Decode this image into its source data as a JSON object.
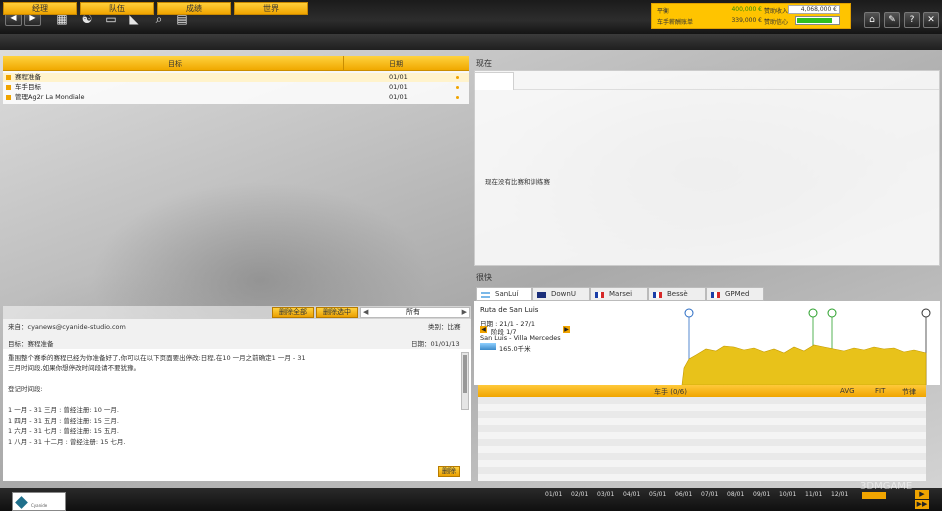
{
  "toolbar": {
    "back_label": "◀",
    "forward_label": "▶",
    "icons": [
      "calendar-icon",
      "team-icon",
      "chart-icon",
      "shoe-icon",
      "search-icon",
      "clipboard-icon"
    ]
  },
  "finance": {
    "balance_label": "平衡",
    "balance_value": "400,000 €",
    "sponsor_income_label": "赞助收入",
    "sponsor_income_value": "4,068,000 €",
    "rider_salary_label": "车手薪酬账单",
    "rider_salary_value": "339,000 €",
    "sponsor_trust_label": "赞助信心",
    "sponsor_trust_level": 0.85
  },
  "right_buttons": [
    "home-icon",
    "wrench-icon",
    "help-icon",
    "close-icon"
  ],
  "right_button_labels": [
    "⌂",
    "✎",
    "?",
    "✕"
  ],
  "nav": {
    "tabs": [
      "经理",
      "队伍",
      "成绩",
      "世界"
    ]
  },
  "objectives": {
    "col_target": "目标",
    "col_date": "日期",
    "rows": [
      {
        "label": "赛程准备",
        "date": "01/01"
      },
      {
        "label": "车手目标",
        "date": "01/01"
      },
      {
        "label": "管理Ag2r La Mondiale",
        "date": "01/01"
      }
    ]
  },
  "message_toolbar": {
    "delete_all": "删除全部",
    "delete_selected": "删除选中",
    "filter_arrow_left": "◀",
    "filter_value": "所有",
    "filter_arrow_right": "▶"
  },
  "message": {
    "from_label": "来自：",
    "from_value": "cyanews@cyanide-studio.com",
    "category_label": "类别：",
    "category_value": "比赛",
    "subject_label": "目标：",
    "subject_value": "赛程准备",
    "date_label": "日期：",
    "date_value": "01/01/13",
    "body_line1": "重围整个赛季的赛程已经为你准备好了,你可以在以下页面要出停改:日程,在10 一月之前确定1 一月 - 31",
    "body_line2": "三月时间段,如果你想停改时间段请不要犹豫。",
    "body_line3": "登记时间段:",
    "body_line4": "1 一月 - 31 三月 : 曾经注册: 10 一月.",
    "body_line5": "1 四月 - 31 五月 : 曾经注册: 15 三月.",
    "body_line6": "1 六月 - 31 七月 : 曾经注册: 15 五月.",
    "body_line7": "1 八月 - 31 十二月 : 曾经注册: 15 七月.",
    "delete_button": "删除"
  },
  "current": {
    "title": "现在",
    "empty_text": "现在没有比赛和训练赛"
  },
  "upcoming": {
    "title": "很快",
    "tabs": [
      {
        "label": "SanLuí",
        "flag": "argentina"
      },
      {
        "label": "DownU",
        "flag": "australia"
      },
      {
        "label": "Marsei",
        "flag": "france"
      },
      {
        "label": "Bessè",
        "flag": "france"
      },
      {
        "label": "GPMed",
        "flag": "france"
      }
    ],
    "race_name": "Ruta de San Luis",
    "dates_label": "日期 : 21/1 - 27/1",
    "stage_prev": "◀",
    "stage_label": "阶段 1/7",
    "stage_next": "▶",
    "stage_route": "San Luis - Villa Mercedes",
    "distance": "165.0千米",
    "riders_header": "车手 (0/6)",
    "col_avg": "AVG",
    "col_fit": "FIT",
    "col_rhythm": "节律"
  },
  "bottom": {
    "logo": "Cyanide",
    "timeline_dates": [
      "01/01",
      "02/01",
      "03/01",
      "04/01",
      "05/01",
      "06/01",
      "07/01",
      "08/01",
      "09/01",
      "10/01",
      "11/01",
      "12/01"
    ],
    "watermark": "3DMGAME"
  },
  "colors": {
    "accent": "#f0a800",
    "accent_light": "#ffd23f",
    "dark": "#1e1e1e",
    "gauge_green": "#2fbf1f"
  }
}
